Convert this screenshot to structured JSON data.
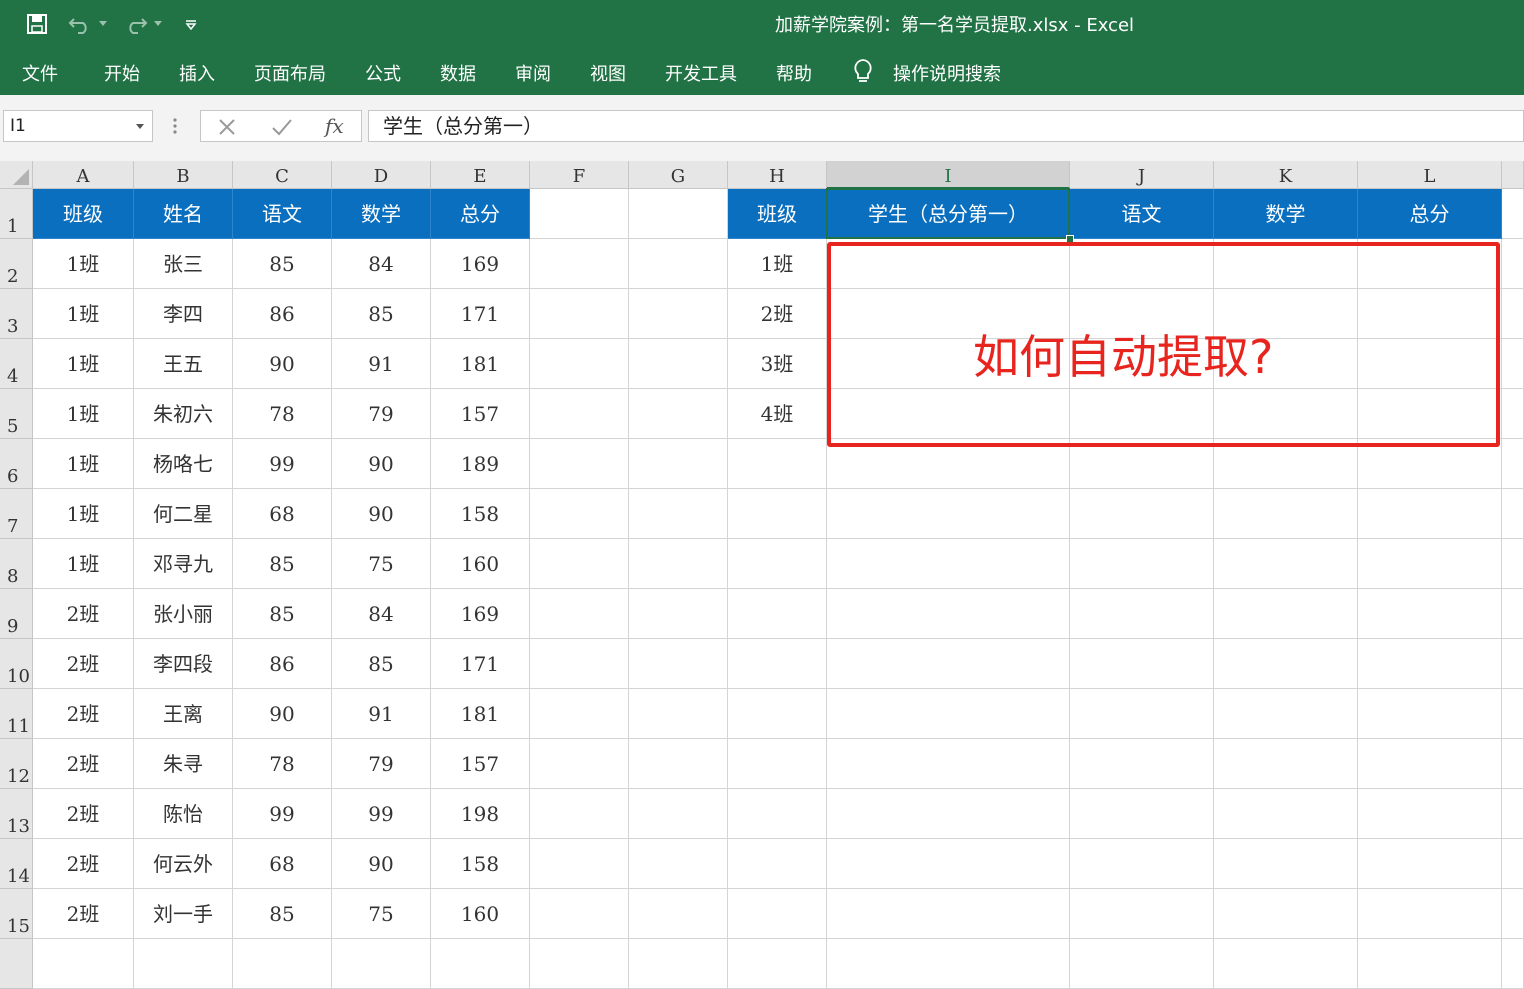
{
  "window": {
    "title": "加薪学院案例：第一名学员提取.xlsx  -  Excel"
  },
  "ribbon": {
    "tabs": [
      "文件",
      "开始",
      "插入",
      "页面布局",
      "公式",
      "数据",
      "审阅",
      "视图",
      "开发工具",
      "帮助"
    ],
    "search_label": "操作说明搜索"
  },
  "formula_bar": {
    "name_box": "I1",
    "content": "学生（总分第一）"
  },
  "grid": {
    "columns": [
      "A",
      "B",
      "C",
      "D",
      "E",
      "F",
      "G",
      "H",
      "I",
      "J",
      "K",
      "L"
    ],
    "selected_column": "I",
    "rows": [
      "1",
      "2",
      "3",
      "4",
      "5",
      "6",
      "7",
      "8",
      "9",
      "10",
      "11",
      "12",
      "13",
      "14",
      "15"
    ]
  },
  "table1": {
    "headers": [
      "班级",
      "姓名",
      "语文",
      "数学",
      "总分"
    ],
    "rows": [
      [
        "1班",
        "张三",
        "85",
        "84",
        "169"
      ],
      [
        "1班",
        "李四",
        "86",
        "85",
        "171"
      ],
      [
        "1班",
        "王五",
        "90",
        "91",
        "181"
      ],
      [
        "1班",
        "朱初六",
        "78",
        "79",
        "157"
      ],
      [
        "1班",
        "杨咯七",
        "99",
        "90",
        "189"
      ],
      [
        "1班",
        "何二星",
        "68",
        "90",
        "158"
      ],
      [
        "1班",
        "邓寻九",
        "85",
        "75",
        "160"
      ],
      [
        "2班",
        "张小丽",
        "85",
        "84",
        "169"
      ],
      [
        "2班",
        "李四段",
        "86",
        "85",
        "171"
      ],
      [
        "2班",
        "王离",
        "90",
        "91",
        "181"
      ],
      [
        "2班",
        "朱寻",
        "78",
        "79",
        "157"
      ],
      [
        "2班",
        "陈怡",
        "99",
        "99",
        "198"
      ],
      [
        "2班",
        "何云外",
        "68",
        "90",
        "158"
      ],
      [
        "2班",
        "刘一手",
        "85",
        "75",
        "160"
      ]
    ]
  },
  "table2": {
    "headers": [
      "班级",
      "学生（总分第一）",
      "语文",
      "数学",
      "总分"
    ],
    "classes": [
      "1班",
      "2班",
      "3班",
      "4班"
    ]
  },
  "annotation": {
    "text": "如何自动提取?",
    "color": "#e8241e"
  },
  "colors": {
    "excel_green": "#217346",
    "header_blue": "#0b6fbf"
  }
}
